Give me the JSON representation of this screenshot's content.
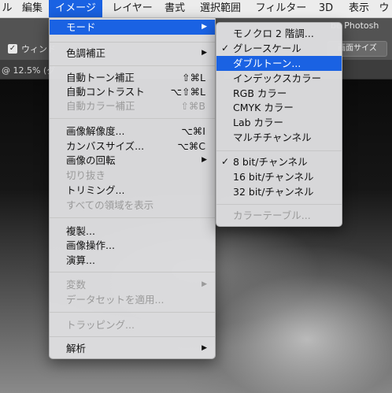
{
  "menubar": {
    "items": [
      "ル",
      "編集",
      "イメージ",
      "レイヤー",
      "書式",
      "選択範囲",
      "フィルター",
      "3D",
      "表示",
      "ウ"
    ],
    "active_index": 2,
    "highlight_color": "#1a62e3"
  },
  "options_bar": {
    "checkbox_label": "ウィンド",
    "checkmark": "✓",
    "app_title": "be Photosh",
    "fit_button": "画面サイズ"
  },
  "document_tab": {
    "label": "@ 12.5% (グ"
  },
  "image_menu": {
    "items": [
      {
        "label": "モード",
        "arrow": "▶",
        "highlighted": true
      },
      {
        "label": "色調補正",
        "arrow": "▶"
      },
      {
        "label": "自動トーン補正",
        "shortcut": "⇧⌘L"
      },
      {
        "label": "自動コントラスト",
        "shortcut": "⌥⇧⌘L"
      },
      {
        "label": "自動カラー補正",
        "shortcut": "⇧⌘B",
        "disabled": true
      },
      {
        "label": "画像解像度...",
        "shortcut": "⌥⌘I"
      },
      {
        "label": "カンバスサイズ...",
        "shortcut": "⌥⌘C"
      },
      {
        "label": "画像の回転",
        "arrow": "▶"
      },
      {
        "label": "切り抜き",
        "disabled": true
      },
      {
        "label": "トリミング..."
      },
      {
        "label": "すべての領域を表示",
        "disabled": true
      },
      {
        "label": "複製..."
      },
      {
        "label": "画像操作..."
      },
      {
        "label": "演算..."
      },
      {
        "label": "変数",
        "arrow": "▶",
        "disabled": true
      },
      {
        "label": "データセットを適用...",
        "disabled": true
      },
      {
        "label": "トラッピング...",
        "disabled": true
      },
      {
        "label": "解析",
        "arrow": "▶"
      }
    ]
  },
  "mode_submenu": {
    "items": [
      {
        "label": "モノクロ 2 階調..."
      },
      {
        "label": "グレースケール",
        "checked": true
      },
      {
        "label": "ダブルトーン...",
        "highlighted": true
      },
      {
        "label": "インデックスカラー"
      },
      {
        "label": "RGB カラー"
      },
      {
        "label": "CMYK カラー"
      },
      {
        "label": "Lab カラー"
      },
      {
        "label": "マルチチャンネル"
      },
      {
        "label": "8 bit/チャンネル",
        "checked": true
      },
      {
        "label": "16 bit/チャンネル"
      },
      {
        "label": "32 bit/チャンネル"
      },
      {
        "label": "カラーテーブル...",
        "disabled": true
      }
    ],
    "check_glyph": "✓"
  }
}
